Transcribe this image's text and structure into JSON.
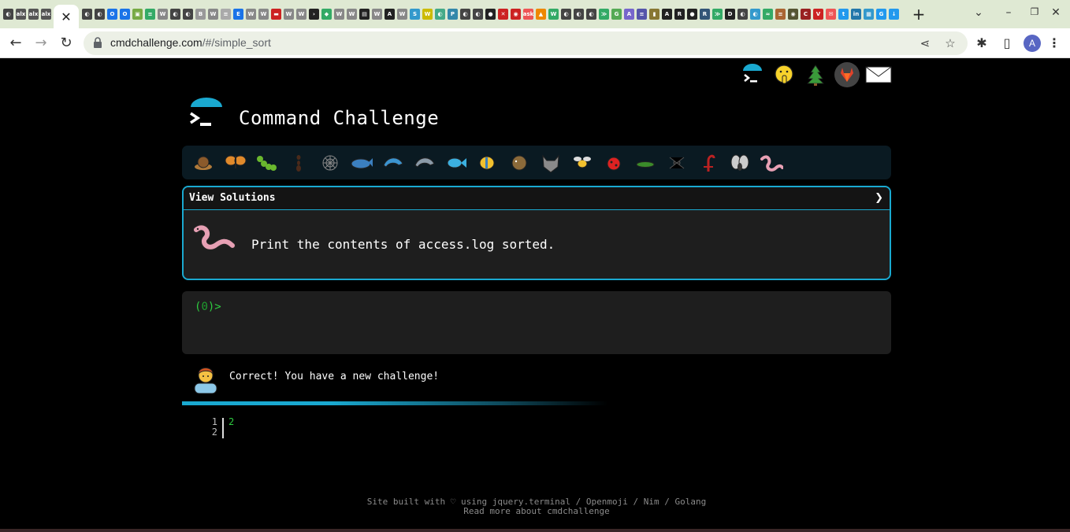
{
  "browser": {
    "url_host": "cmdchallenge.com",
    "url_path": "/#/simple_sort",
    "close_tab_glyph": "✕",
    "new_tab_glyph": "+",
    "window_controls": [
      "–",
      "❐",
      "✕"
    ],
    "avatar_letter": "A",
    "tab_favicons": [
      {
        "t": "◐",
        "c": "#444"
      },
      {
        "t": "alx",
        "c": "#555"
      },
      {
        "t": "alx",
        "c": "#555"
      },
      {
        "t": "alx",
        "c": "#555"
      },
      {
        "t": "alx",
        "c": "#555"
      },
      {
        "t": "◐",
        "c": "#444"
      },
      {
        "t": "◐",
        "c": "#444"
      },
      {
        "t": "O",
        "c": "#1a73e8"
      },
      {
        "t": "O",
        "c": "#1a73e8"
      },
      {
        "t": "▣",
        "c": "#7a4"
      },
      {
        "t": "≡",
        "c": "#3a6"
      },
      {
        "t": "W",
        "c": "#888"
      },
      {
        "t": "◐",
        "c": "#444"
      },
      {
        "t": "◐",
        "c": "#444"
      },
      {
        "t": "B",
        "c": "#999"
      },
      {
        "t": "W",
        "c": "#888"
      },
      {
        "t": "≡",
        "c": "#aaa"
      },
      {
        "t": "E",
        "c": "#1a73e8"
      },
      {
        "t": "W",
        "c": "#888"
      },
      {
        "t": "W",
        "c": "#888"
      },
      {
        "t": "▬",
        "c": "#c22"
      },
      {
        "t": "W",
        "c": "#888"
      },
      {
        "t": "W",
        "c": "#888"
      },
      {
        "t": "›",
        "c": "#222"
      },
      {
        "t": "◆",
        "c": "#3a6"
      },
      {
        "t": "W",
        "c": "#888"
      },
      {
        "t": "W",
        "c": "#888"
      },
      {
        "t": "▤",
        "c": "#222"
      },
      {
        "t": "W",
        "c": "#888"
      },
      {
        "t": "A",
        "c": "#222"
      },
      {
        "t": "W",
        "c": "#888"
      },
      {
        "t": "S",
        "c": "#39c"
      },
      {
        "t": "W",
        "c": "#cb0"
      },
      {
        "t": "◐",
        "c": "#4a8"
      },
      {
        "t": "P",
        "c": "#38a"
      },
      {
        "t": "◐",
        "c": "#444"
      },
      {
        "t": "◐",
        "c": "#444"
      },
      {
        "t": "●",
        "c": "#222"
      },
      {
        "t": "✕",
        "c": "#c22"
      },
      {
        "t": "◉",
        "c": "#c22"
      },
      {
        "t": "ask",
        "c": "#e55"
      },
      {
        "t": "▲",
        "c": "#e80"
      },
      {
        "t": "W",
        "c": "#3a6"
      },
      {
        "t": "◐",
        "c": "#444"
      },
      {
        "t": "◐",
        "c": "#444"
      },
      {
        "t": "◐",
        "c": "#444"
      },
      {
        "t": "≫",
        "c": "#3a6"
      },
      {
        "t": "G",
        "c": "#5a5"
      },
      {
        "t": "A",
        "c": "#76c"
      },
      {
        "t": "≡",
        "c": "#55a"
      },
      {
        "t": "▮",
        "c": "#873"
      },
      {
        "t": "A",
        "c": "#222"
      },
      {
        "t": "R",
        "c": "#222"
      },
      {
        "t": "●",
        "c": "#222"
      },
      {
        "t": "R",
        "c": "#357"
      },
      {
        "t": "≫",
        "c": "#3a6"
      },
      {
        "t": "D",
        "c": "#222"
      },
      {
        "t": "◐",
        "c": "#444"
      },
      {
        "t": "◐",
        "c": "#39c"
      },
      {
        "t": "≈",
        "c": "#3a6"
      },
      {
        "t": "≡",
        "c": "#a63"
      },
      {
        "t": "◉",
        "c": "#553"
      },
      {
        "t": "C",
        "c": "#922"
      },
      {
        "t": "V",
        "c": "#c22"
      },
      {
        "t": "✉",
        "c": "#e55"
      },
      {
        "t": "t",
        "c": "#29e"
      },
      {
        "t": "in",
        "c": "#27a"
      },
      {
        "t": "▦",
        "c": "#39c"
      },
      {
        "t": "G",
        "c": "#29e"
      },
      {
        "t": "↓",
        "c": "#29e"
      }
    ]
  },
  "page": {
    "title": "Command Challenge",
    "top_icons": [
      "terminal-logo",
      "shush-face",
      "tree",
      "gitlab",
      "envelope"
    ],
    "animals": [
      "snail",
      "butterfly",
      "caterpillar",
      "ant",
      "spiderweb",
      "whale",
      "dolphin",
      "dolphin-grey",
      "fish",
      "tropical-fish",
      "blowfish",
      "wolf",
      "bee",
      "ladybug",
      "cricket",
      "spider",
      "scorpion",
      "fly",
      "worm"
    ],
    "challenge": {
      "view_solutions_label": "View Solutions",
      "chevron": "❯",
      "description": "Print the contents of access.log sorted."
    },
    "terminal": {
      "prompt_open": "(",
      "prompt_num": "0",
      "prompt_close": ")>"
    },
    "message": "Correct! You have a new challenge!",
    "progress_fraction": 0.6,
    "editor": {
      "line_numbers": [
        "1",
        "2"
      ],
      "code": "2"
    },
    "footer": {
      "line1": "Site built with ♡ using jquery.terminal / Openmoji / Nim / Golang",
      "line2": "Read more about cmdchallenge"
    }
  }
}
